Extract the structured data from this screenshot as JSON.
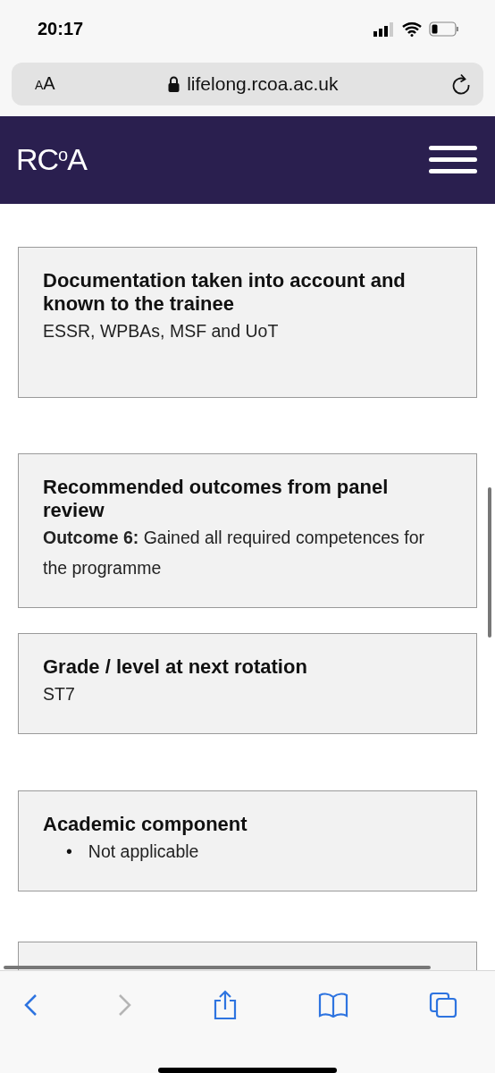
{
  "status_bar": {
    "time": "20:17"
  },
  "address_bar": {
    "text_size_button": "AA",
    "url": "lifelong.rcoa.ac.uk"
  },
  "header": {
    "logo": "RC$^{o}$A"
  },
  "cards": [
    {
      "kind": "text",
      "title": "Documentation taken into account and known to the trainee",
      "body": "ESSR, WPBAs, MSF and UoT"
    },
    {
      "kind": "text",
      "title": "Recommended outcomes from panel review",
      "body": "**Outcome 6:** Gained all required competences for the programme"
    },
    {
      "kind": "text",
      "title": "Grade / level at next rotation",
      "body": "ST7"
    },
    {
      "kind": "list",
      "title": "Academic component",
      "items": [
        {
          "bullet": "•",
          "text": "Not applicable"
        }
      ]
    },
    {
      "kind": "empty"
    }
  ],
  "toolbar": [
    {
      "kind": "back",
      "disabled": false
    },
    {
      "kind": "forward",
      "disabled": true
    },
    {
      "kind": "share",
      "disabled": false
    },
    {
      "kind": "bookmarks",
      "disabled": false
    },
    {
      "kind": "tabs",
      "disabled": false
    }
  ]
}
